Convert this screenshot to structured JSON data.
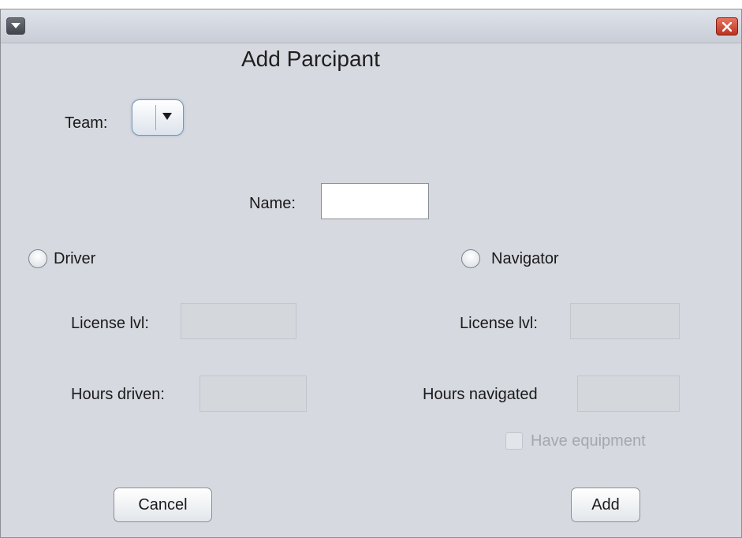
{
  "dialog": {
    "title": "Add Parcipant",
    "window_menu_icon": "chevron-down-icon",
    "close_icon": "close-icon"
  },
  "team": {
    "label": "Team:",
    "selected": ""
  },
  "name": {
    "label": "Name:",
    "value": ""
  },
  "driver": {
    "radio_label": "Driver",
    "license_label": "License lvl:",
    "license_value": "",
    "hours_label": "Hours driven:",
    "hours_value": ""
  },
  "navigator": {
    "radio_label": "Navigator",
    "license_label": "License lvl:",
    "license_value": "",
    "hours_label": "Hours navigated",
    "hours_value": "",
    "equipment_label": "Have equipment"
  },
  "buttons": {
    "cancel": "Cancel",
    "add": "Add"
  }
}
